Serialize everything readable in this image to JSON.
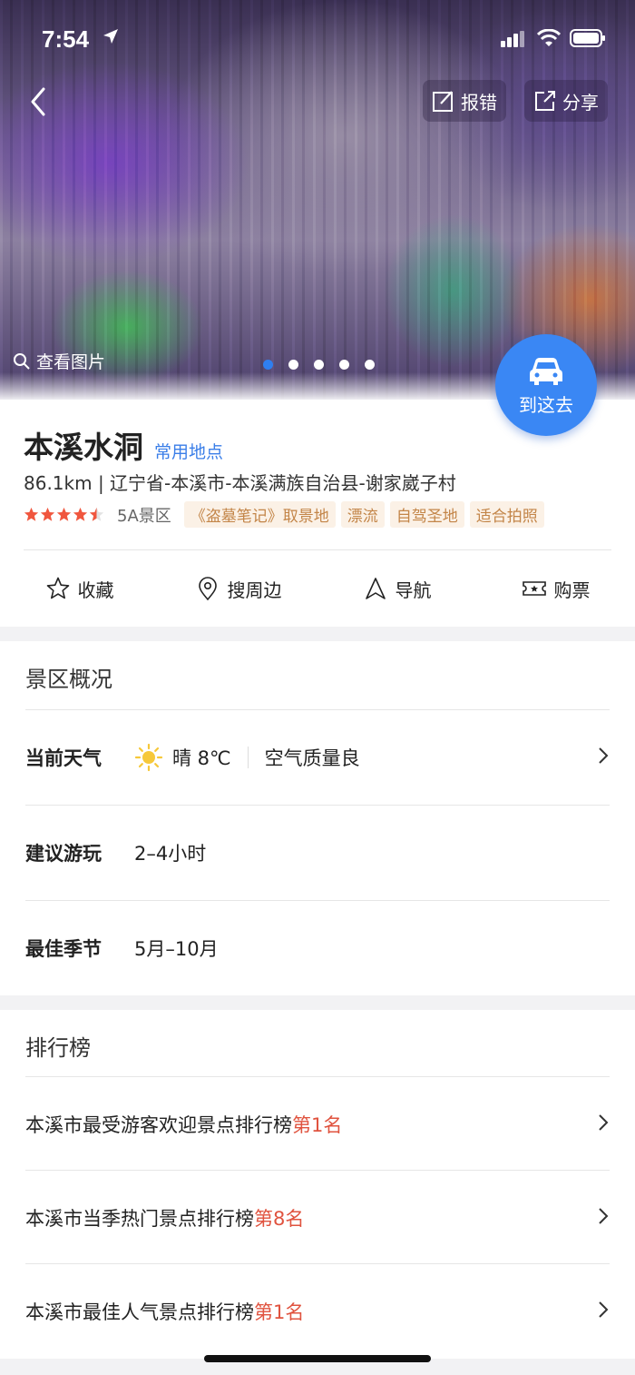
{
  "status_bar": {
    "time": "7:54"
  },
  "header": {
    "report_label": "报错",
    "share_label": "分享"
  },
  "gallery": {
    "view_photos_label": "查看图片",
    "photo_count": 5,
    "active_index": 0
  },
  "go_button": {
    "label": "到这去"
  },
  "place": {
    "name": "本溪水洞",
    "common_tag": "常用地点",
    "address": "86.1km | 辽宁省-本溪市-本溪满族自治县-谢家崴子村",
    "rating": 4.5,
    "level": "5A景区",
    "tags": [
      "《盗墓笔记》取景地",
      "漂流",
      "自驾圣地",
      "适合拍照"
    ]
  },
  "actions": [
    {
      "label": "收藏",
      "icon": "star-outline-icon"
    },
    {
      "label": "搜周边",
      "icon": "location-pin-icon"
    },
    {
      "label": "导航",
      "icon": "navigation-arrow-icon"
    },
    {
      "label": "购票",
      "icon": "ticket-icon"
    }
  ],
  "overview": {
    "title": "景区概况",
    "weather_label": "当前天气",
    "weather_value": "晴 8℃",
    "air_quality": "空气质量良",
    "duration_label": "建议游玩",
    "duration_value": "2–4小时",
    "season_label": "最佳季节",
    "season_value": "5月–10月"
  },
  "ranking": {
    "title": "排行榜",
    "items": [
      {
        "text": "本溪市最受游客欢迎景点排行榜",
        "rank": "第1名"
      },
      {
        "text": "本溪市当季热门景点排行榜",
        "rank": "第8名"
      },
      {
        "text": "本溪市最佳人气景点排行榜",
        "rank": "第1名"
      }
    ]
  },
  "colors": {
    "accent": "#3a87f4",
    "tag_text": "#c38548",
    "rank_highlight": "#e0533f",
    "star": "#f0563e"
  }
}
